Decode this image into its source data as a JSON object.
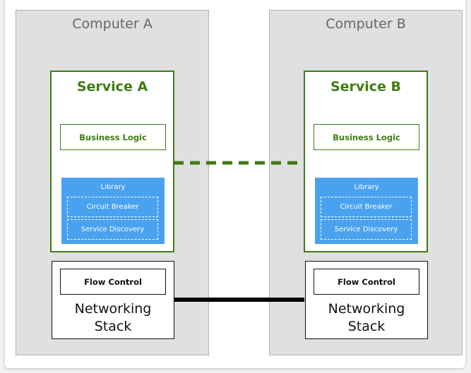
{
  "computers": [
    {
      "title": "Computer A",
      "service": "Service A",
      "business_logic": "Business Logic",
      "library": "Library",
      "circuit_breaker": "Circuit Breaker",
      "service_discovery": "Service Discovery",
      "flow_control": "Flow Control",
      "networking_1": "Networking",
      "networking_2": "Stack"
    },
    {
      "title": "Computer B",
      "service": "Service B",
      "business_logic": "Business Logic",
      "library": "Library",
      "circuit_breaker": "Circuit Breaker",
      "service_discovery": "Service Discovery",
      "flow_control": "Flow Control",
      "networking_1": "Networking",
      "networking_2": "Stack"
    }
  ],
  "connections": [
    {
      "from": "Service A",
      "to": "Service B",
      "style": "dashed",
      "color": "#3e7d12"
    },
    {
      "from": "Networking Stack A",
      "to": "Networking Stack B",
      "style": "solid",
      "color": "#000000"
    }
  ]
}
